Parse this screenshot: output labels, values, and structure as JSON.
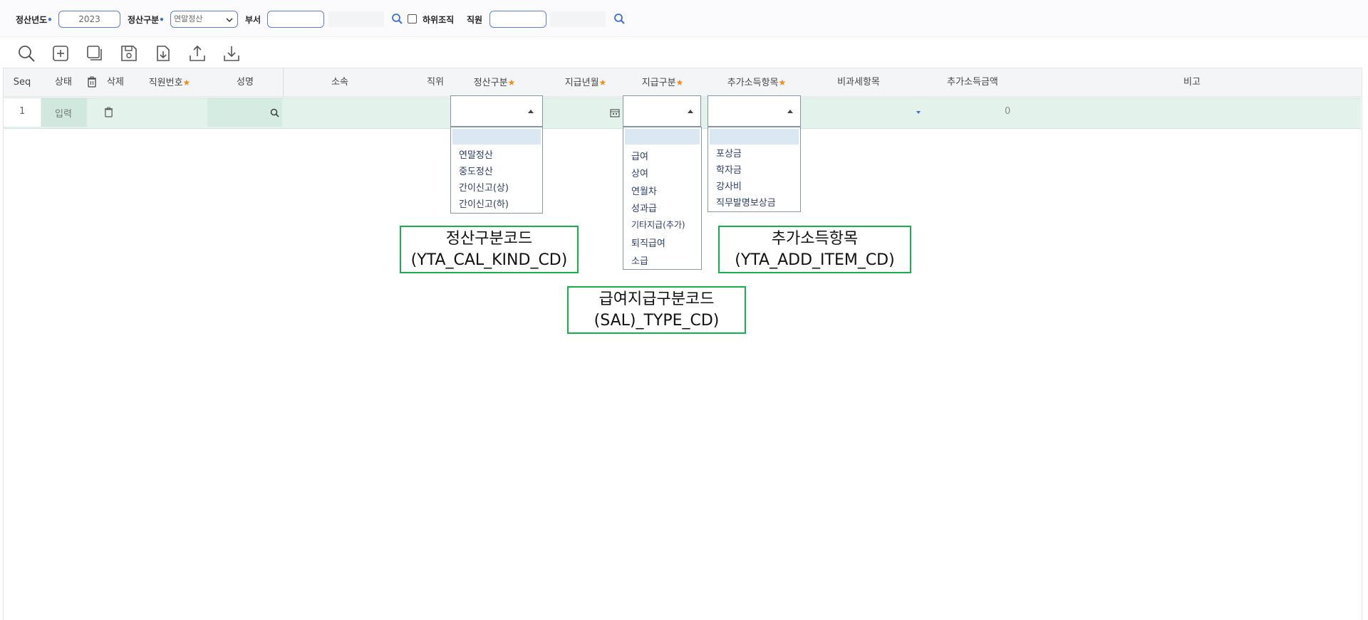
{
  "filters": {
    "year_label": "정산년도",
    "year_value": "2023",
    "calc_kind_label": "정산구분",
    "calc_kind_value": "연말정산",
    "dept_label": "부서",
    "dept_value": "",
    "sub_org_label": "하위조직",
    "employee_label": "직원",
    "employee_value": "",
    "required_mark": "•"
  },
  "toolbar": [
    "search-icon",
    "add-icon",
    "copy-icon",
    "save-icon",
    "file-export-icon",
    "upload-icon",
    "download-icon"
  ],
  "grid": {
    "columns": {
      "seq": "Seq",
      "status": "상태",
      "delete": "삭제",
      "emp_no": "직원번호",
      "name": "성명",
      "affiliation": "소속",
      "position": "직위",
      "calc_kind": "정산구분",
      "pay_month": "지급년월",
      "pay_type": "지급구분",
      "add_item": "추가소득항목",
      "nontax_item": "비과세항목",
      "add_amount": "추가소득금액",
      "remark": "비고"
    },
    "required_star": "★",
    "row": {
      "seq": "1",
      "status": "입력",
      "add_amount": "0"
    }
  },
  "dropdowns": {
    "calc_kind": [
      "",
      "연말정산",
      "중도정산",
      "간이신고(상)",
      "간이신고(하)"
    ],
    "pay_type": [
      "",
      "급여",
      "상여",
      "연월차",
      "성과급",
      "기타지급(추가)",
      "퇴직급여",
      "소급"
    ],
    "add_item": [
      "",
      "포상금",
      "학자금",
      "강사비",
      "직무발명보상금"
    ]
  },
  "annotations": {
    "calc_kind_code": [
      "정산구분코드",
      "(YTA_CAL_KIND_CD)"
    ],
    "pay_type_code": [
      "급여지급구분코드",
      "(SAL)_TYPE_CD)"
    ],
    "add_item_code": [
      "추가소득항목",
      "(YTA_ADD_ITEM_CD)"
    ]
  },
  "colors": {
    "accent": "#3b6fd8",
    "row_highlight": "#e3f3ec",
    "annotation_border": "#14b24a",
    "required_star": "#f08c1a"
  }
}
